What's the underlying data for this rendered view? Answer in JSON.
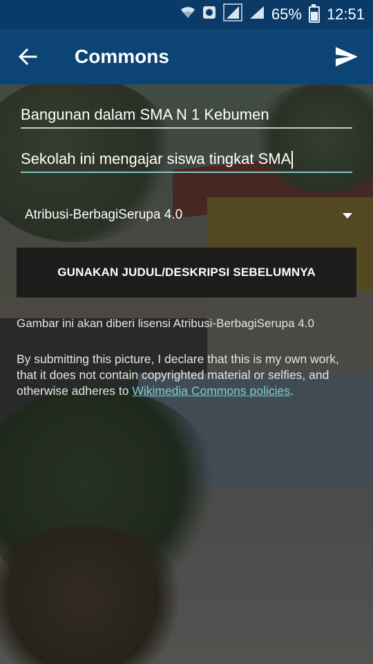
{
  "status_bar": {
    "battery_percent": "65%",
    "time": "12:51",
    "battery_level": 0.65,
    "icons": [
      "wifi-icon",
      "data-saver-icon",
      "signal-sim1-icon",
      "signal-sim2-icon",
      "battery-icon"
    ]
  },
  "app_bar": {
    "title": "Commons",
    "back_icon": "arrow-back-icon",
    "send_icon": "send-icon",
    "background": "#0c4476"
  },
  "form": {
    "title_value": "Bangunan dalam SMA N 1 Kebumen",
    "description_value": "Sekolah ini mengajar siswa tingkat SMA",
    "license_selected": "Atribusi-BerbagiSerupa 4.0",
    "previous_button_label": "GUNAKAN JUDUL/DESKRIPSI SEBELUMNYA",
    "license_note": "Gambar ini akan diberi lisensi Atribusi-BerbagiSerupa 4.0",
    "declaration_text": "By submitting this picture, I declare that this is my own work, that it does not contain copyrighted material or selfies, and otherwise adheres to ",
    "declaration_link": "Wikimedia Commons policies",
    "declaration_end": ".",
    "accent_color": "#7fc9c7"
  }
}
